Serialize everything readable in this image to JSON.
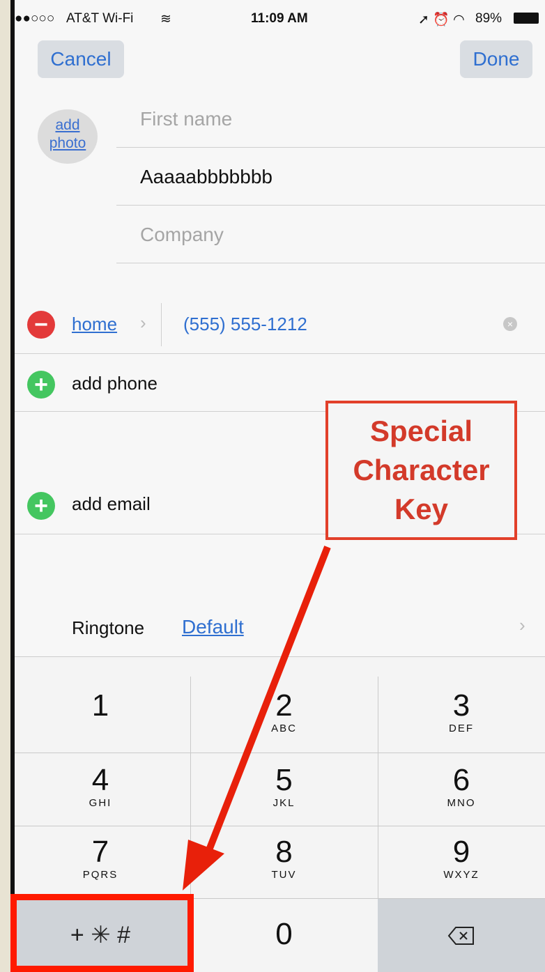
{
  "status_bar": {
    "carrier": "AT&T Wi-Fi",
    "time": "11:09 AM",
    "battery": "89%"
  },
  "nav": {
    "cancel": "Cancel",
    "done": "Done"
  },
  "avatar": {
    "line1": "add",
    "line2": "photo"
  },
  "fields": {
    "first_name_placeholder": "First name",
    "last_name_value": "Aaaaabbbbbbb",
    "company_placeholder": "Company"
  },
  "phone": {
    "label": "home",
    "value": "(555) 555-1212",
    "add_phone": "add phone"
  },
  "email": {
    "add_email": "add email"
  },
  "ringtone": {
    "label": "Ringtone",
    "value": "Default"
  },
  "keypad": {
    "keys": [
      {
        "digit": "1",
        "letters": ""
      },
      {
        "digit": "2",
        "letters": "ABC"
      },
      {
        "digit": "3",
        "letters": "DEF"
      },
      {
        "digit": "4",
        "letters": "GHI"
      },
      {
        "digit": "5",
        "letters": "JKL"
      },
      {
        "digit": "6",
        "letters": "MNO"
      },
      {
        "digit": "7",
        "letters": "PQRS"
      },
      {
        "digit": "8",
        "letters": "TUV"
      },
      {
        "digit": "9",
        "letters": "WXYZ"
      },
      {
        "digit": "0",
        "letters": ""
      }
    ],
    "special": "+ ✳ #"
  },
  "annotation": {
    "line1": "Special",
    "line2": "Character",
    "line3": "Key",
    "color": "#e2402a"
  }
}
